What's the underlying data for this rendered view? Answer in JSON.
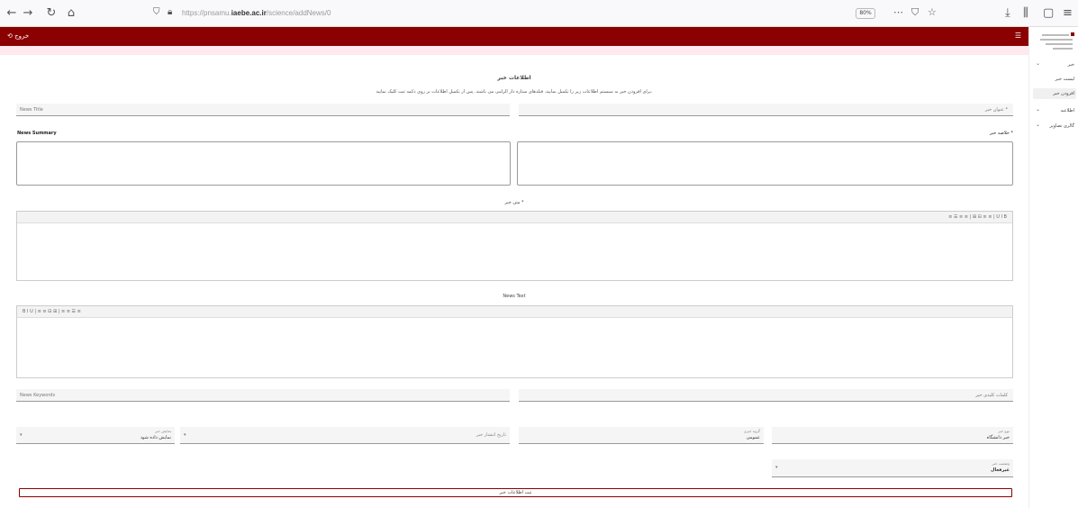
{
  "browser": {
    "url_prefix": "https://pnsamu.",
    "url_domain": "iaebe.ac.ir",
    "url_path": "/science/addNews/0",
    "zoom": "80%"
  },
  "topbar": {
    "left_text": "⟲ خروج"
  },
  "sidebar": {
    "items": [
      {
        "label": "خبر"
      },
      {
        "label": "لیست خبر"
      },
      {
        "label": "افزودن خبر"
      },
      {
        "label": "اطلاعیه"
      },
      {
        "label": "گالری تصاویر"
      }
    ]
  },
  "form": {
    "title": "اطلاعات خبر",
    "hint": "برای افزودن خبر به سیستم اطلاعات زیر را تکمیل نمایید. فیلدهای ستاره دار الزامی می باشند. پس از تکمیل اطلاعات بر روی دکمه ثبت کلیک نمایید.",
    "title_fa_placeholder": "عنوان خبر *",
    "title_en_placeholder": "News Title",
    "summary_fa_label": "خلاصه خبر *",
    "summary_en_label": "News Summary",
    "body_fa_label": "متن خبر *",
    "body_en_label": "News Text",
    "editor_toolbar_fa": "≡ ☰ ≡ ≡ | ⊞ ⊟ ≡ ≡ | U I B",
    "editor_toolbar_en": "B I U | ≡ ≡ ⊟ ⊞ | ≡ ≡ ☰ ≡",
    "keywords_fa_placeholder": "کلمات کلیدی خبر",
    "keywords_en_placeholder": "News Keywords",
    "selects": [
      {
        "caption": "نوع خبر",
        "value": "خبر دانشگاه"
      },
      {
        "caption": "گروه خبری",
        "value": "عمومی"
      },
      {
        "caption": "",
        "value": "تاریخ انتشار خبر"
      },
      {
        "caption": "نمایش خبر",
        "value": "نمایش داده شود"
      }
    ],
    "status_caption": "وضعیت خبر",
    "status_value": "غیرفعال",
    "submit_label": "ثبت اطلاعات خبر"
  }
}
